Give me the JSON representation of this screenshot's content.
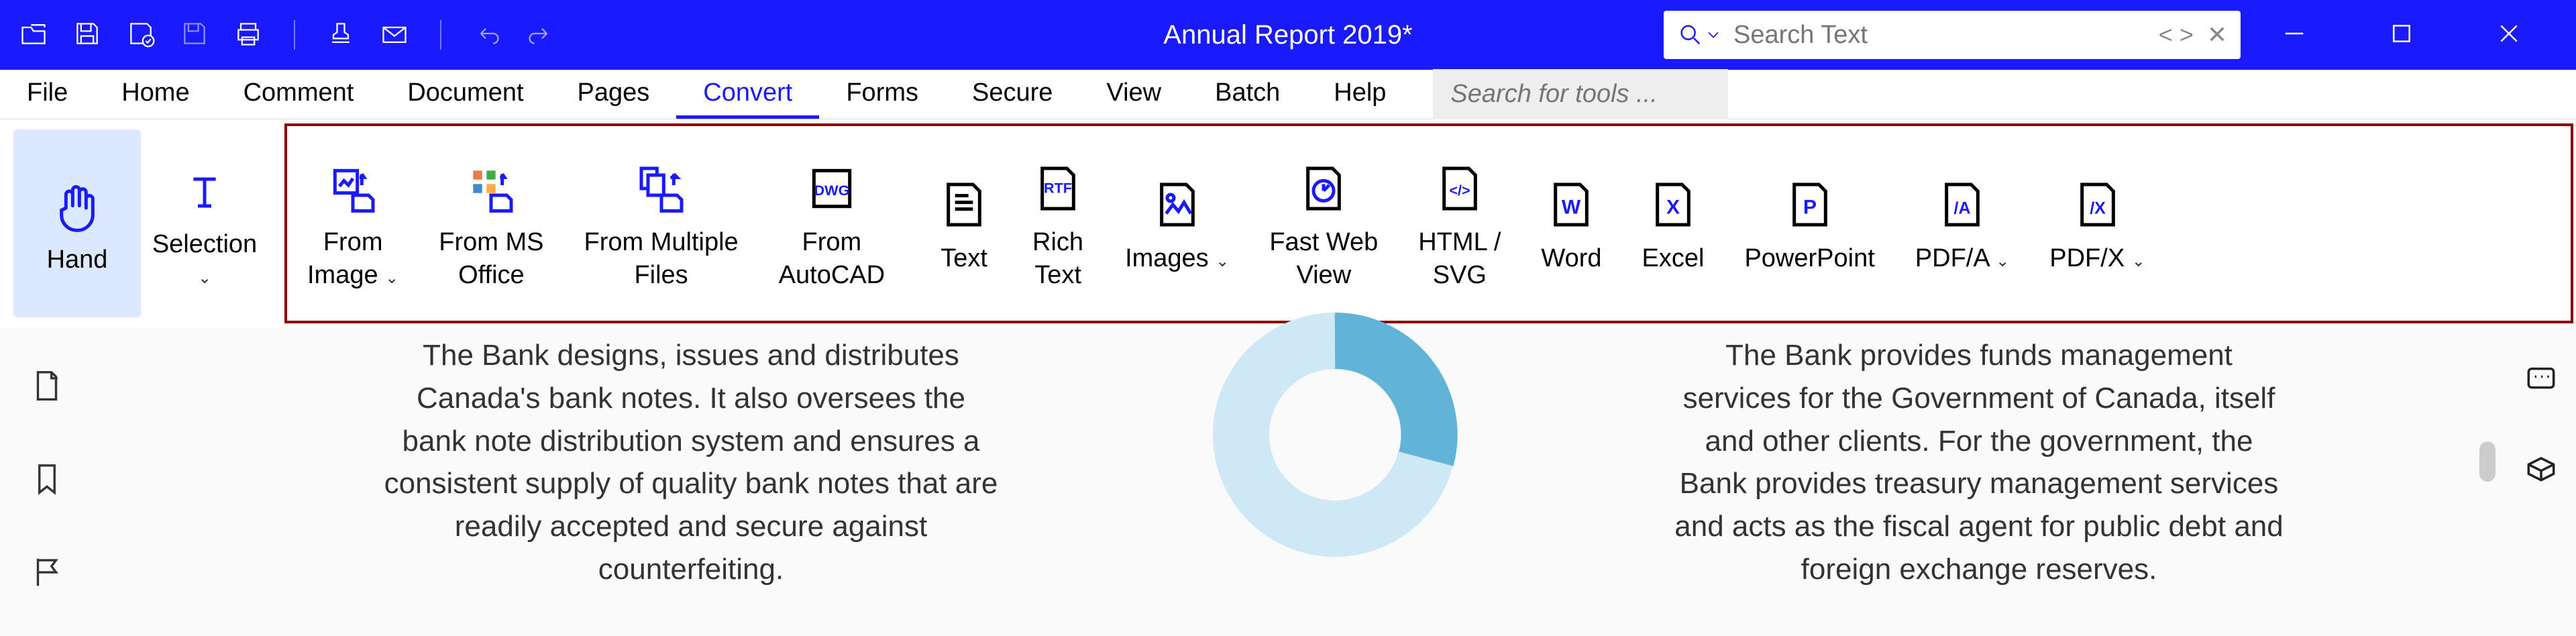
{
  "title": "Annual Report 2019*",
  "search": {
    "placeholder": "Search Text"
  },
  "menu": {
    "items": [
      "File",
      "Home",
      "Comment",
      "Document",
      "Pages",
      "Convert",
      "Forms",
      "Secure",
      "View",
      "Batch",
      "Help"
    ],
    "activeIndex": 5,
    "toolSearchPlaceholder": "Search for tools ..."
  },
  "ribbon": {
    "tools": {
      "hand": "Hand",
      "selection": "Selection"
    },
    "group_create": [
      {
        "id": "from-image",
        "label": "From\nImage",
        "dropdown": true
      },
      {
        "id": "from-ms-office",
        "label": "From MS\nOffice"
      },
      {
        "id": "from-multiple-files",
        "label": "From Multiple\nFiles"
      },
      {
        "id": "from-autocad",
        "label": "From\nAutoCAD"
      }
    ],
    "group_export": [
      {
        "id": "text",
        "label": "Text"
      },
      {
        "id": "rich-text",
        "label": "Rich\nText"
      },
      {
        "id": "images",
        "label": "Images",
        "dropdown": true
      },
      {
        "id": "fast-web-view",
        "label": "Fast Web\nView"
      },
      {
        "id": "html-svg",
        "label": "HTML /\nSVG"
      },
      {
        "id": "word",
        "label": "Word"
      },
      {
        "id": "excel",
        "label": "Excel"
      },
      {
        "id": "powerpoint",
        "label": "PowerPoint"
      },
      {
        "id": "pdfa",
        "label": "PDF/A",
        "dropdown": true
      },
      {
        "id": "pdfx",
        "label": "PDF/X",
        "dropdown": true
      }
    ]
  },
  "doc": {
    "col1": "The Bank designs, issues and distributes Canada's bank notes. It also oversees the bank note distribution system and ensures a consistent supply of quality bank notes that are readily accepted and secure against counterfeiting.",
    "col2": "The Bank provides funds management services for the Government of Canada, itself and other clients. For the government, the Bank provides treasury management services and acts as the fiscal agent for public debt and foreign exchange reserves."
  }
}
